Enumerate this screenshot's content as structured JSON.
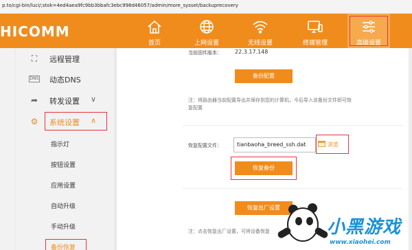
{
  "browser": {
    "url": "p.to/cgi-bin/luci/;stok=4ed4aea9fc9bb3bbafc3ebc998d46057/admin/more_sysset/backuprecovery"
  },
  "header": {
    "brand": "HICOMM",
    "nav": [
      {
        "label": "首页",
        "icon": "home-icon"
      },
      {
        "label": "上网设置",
        "icon": "globe-icon"
      },
      {
        "label": "无线设置",
        "icon": "wifi-icon"
      },
      {
        "label": "终端管理",
        "icon": "device-icon"
      },
      {
        "label": "高级设置",
        "icon": "sliders-icon",
        "active": true
      }
    ]
  },
  "sidebar": {
    "items": [
      {
        "label": "远程管理",
        "icon": "remote-icon"
      },
      {
        "label": "动态DNS",
        "icon": "dns-icon"
      },
      {
        "label": "转发设置",
        "icon": "forward-icon",
        "chevron": "∨"
      },
      {
        "label": "系统设置",
        "icon": "gear-icon",
        "chevron": "∧",
        "active": true
      }
    ],
    "sub_items": [
      "指示灯",
      "按钮设置",
      "应用设置",
      "自动升级",
      "手动升级",
      "备份恢复"
    ]
  },
  "content": {
    "firmware_label": "当前固件版本：",
    "firmware_value": "22.3.17.148",
    "backup_button": "备份配置",
    "backup_note": "注：将路由器当前配置导出并保存到您的计算机，今后导入该备份文件即可恢复配置",
    "restore_label": "恢复配置文件：",
    "restore_file": "tianbaoha_breed_ssh.dat",
    "browse_label": "浏览",
    "restore_button": "恢复备份",
    "factory_button": "恢复出厂设置",
    "factory_note": "注：点击恢复出厂设置，可将设备恢复"
  },
  "watermark": {
    "title": "小黑游戏",
    "url": "www.xiaohei.com"
  },
  "colors": {
    "accent": "#f08c1c",
    "highlight_box": "#e8323c",
    "watermark": "#1b92d6"
  }
}
